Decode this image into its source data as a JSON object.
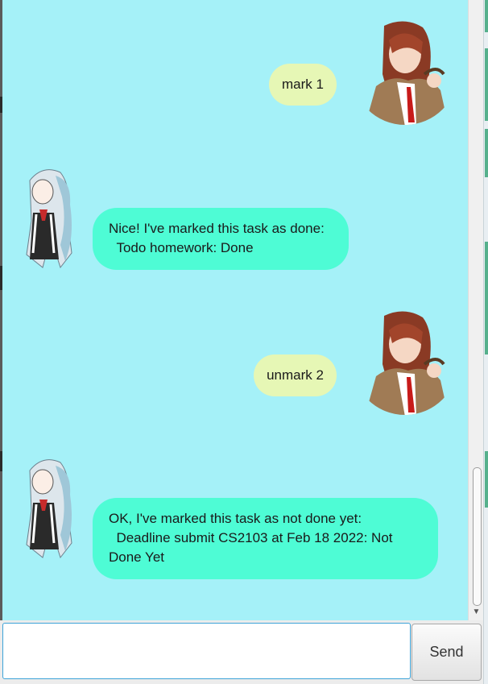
{
  "messages": [
    {
      "sender": "user",
      "text": "mark 1",
      "avatar": "user-avatar-red-haired-girl"
    },
    {
      "sender": "bot",
      "text": "Nice! I've marked this task as done:\n  Todo homework: Done",
      "avatar": "bot-avatar-silver-haired-girl"
    },
    {
      "sender": "user",
      "text": "unmark 2",
      "avatar": "user-avatar-red-haired-girl"
    },
    {
      "sender": "bot",
      "text": "OK, I've marked this task as not done yet:\n  Deadline submit CS2103 at Feb 18 2022: Not Done Yet",
      "avatar": "bot-avatar-silver-haired-girl"
    }
  ],
  "input": {
    "value": "",
    "placeholder": ""
  },
  "send_button": {
    "label": "Send"
  },
  "colors": {
    "chat_background": "#a5f1f8",
    "user_bubble": "#e6f7b5",
    "bot_bubble": "#4efcd5",
    "input_border": "#3da3d8"
  }
}
